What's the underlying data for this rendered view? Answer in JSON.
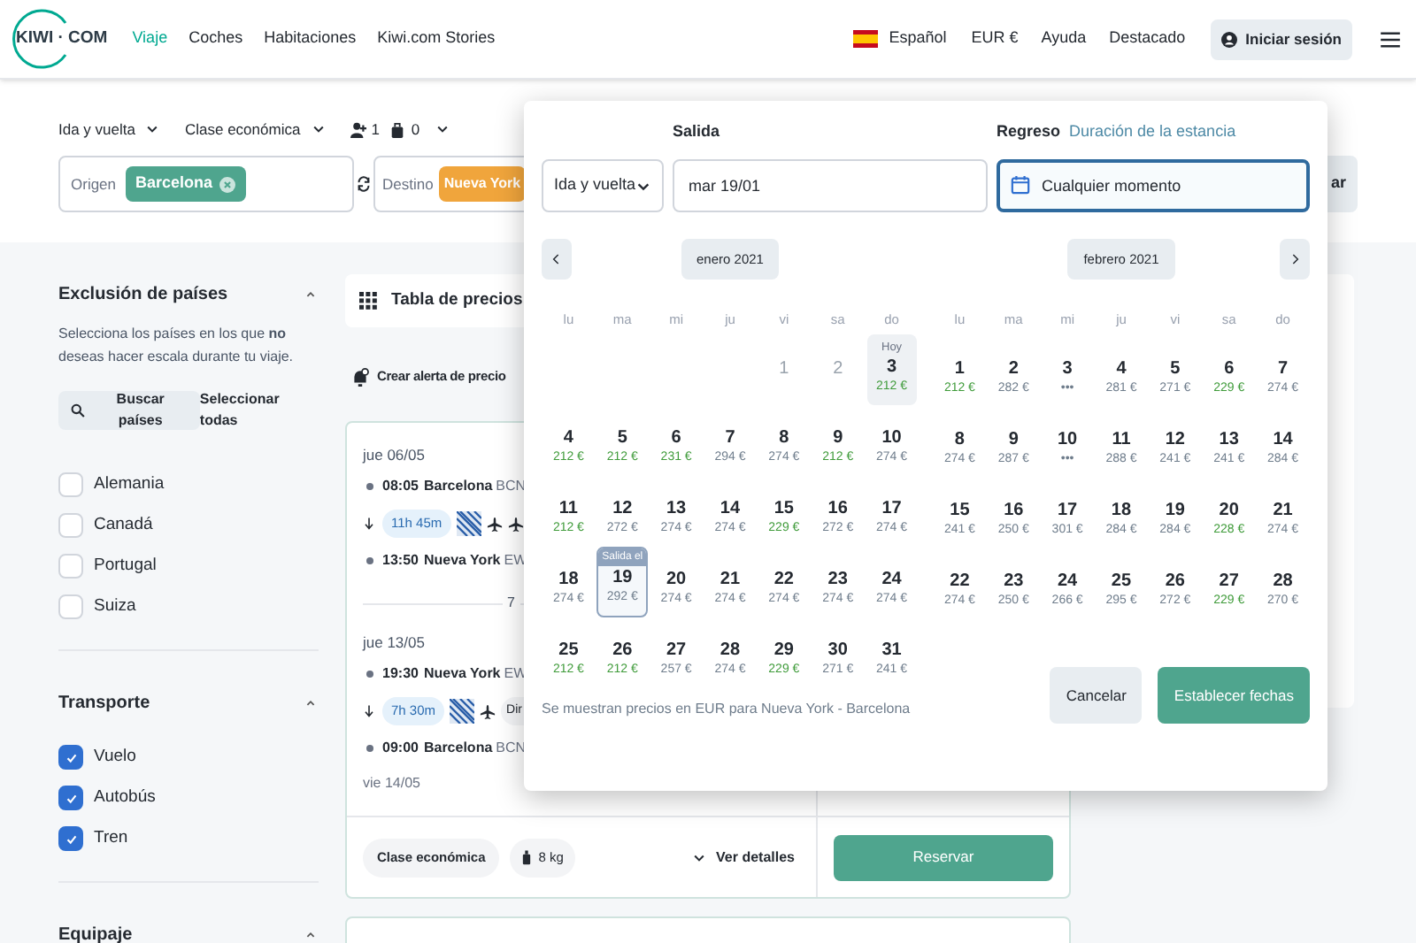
{
  "header": {
    "logo": "KIWI · COM",
    "nav": [
      {
        "label": "Viaje",
        "selected": true
      },
      {
        "label": "Coches",
        "selected": false
      },
      {
        "label": "Habitaciones",
        "selected": false
      },
      {
        "label": "Kiwi.com Stories",
        "selected": false
      }
    ],
    "language": "Español",
    "currency": "EUR €",
    "links": [
      "Ayuda",
      "Destacado"
    ],
    "login": "Iniciar sesión"
  },
  "search": {
    "trip_type": "Ida y vuelta",
    "cabin": "Clase económica",
    "adults": "1",
    "bags": "0",
    "origin": {
      "label": "Origen",
      "chip": "Barcelona"
    },
    "destination": {
      "label": "Destino",
      "chip": "Nueva York"
    },
    "search_button": "ar"
  },
  "sidebar": {
    "sections": [
      {
        "kind": "countries",
        "title": "Exclusión de países",
        "expanded": true,
        "description": "Selecciona los países en los que **no** deseas hacer escala durante tu viaje.",
        "search_button": "Buscar países",
        "select_all": "Seleccionar todas",
        "options": [
          {
            "label": "Alemania",
            "checked": false
          },
          {
            "label": "Canadá",
            "checked": false
          },
          {
            "label": "Portugal",
            "checked": false
          },
          {
            "label": "Suiza",
            "checked": false
          }
        ]
      },
      {
        "kind": "checklist",
        "title": "Transporte",
        "expanded": true,
        "options": [
          {
            "label": "Vuelo",
            "checked": true
          },
          {
            "label": "Autobús",
            "checked": true
          },
          {
            "label": "Tren",
            "checked": true
          }
        ]
      },
      {
        "kind": "checklist",
        "title": "Equipaje",
        "expanded": true
      }
    ]
  },
  "results": {
    "price_table": "Tabla de precios",
    "price_alert": "Crear alerta de precio",
    "card": {
      "legs": [
        {
          "date": "jue 06/05",
          "depart": {
            "time": "08:05",
            "city": "Barcelona",
            "code": "BCN"
          },
          "duration": "11h 45m",
          "segments": [
            {
              "kind": "flight"
            },
            {
              "kind": "flight"
            }
          ],
          "arrive": {
            "time": "13:50",
            "city": "Nueva York",
            "code": "EW"
          }
        },
        {
          "date": "jue 13/05",
          "depart": {
            "time": "19:30",
            "city": "Nueva York",
            "code": "EW"
          },
          "duration": "7h 30m",
          "segments": [
            {
              "kind": "flight"
            },
            {
              "kind": "chip",
              "label": "Dir"
            }
          ],
          "arrive": {
            "time": "09:00",
            "city": "Barcelona",
            "code": "BCN"
          },
          "arrival_date": "vie 14/05"
        }
      ],
      "nights": "7",
      "cabin": "Clase económica",
      "bag": "8 kg",
      "details": "Ver detalles",
      "book": "Reservar"
    }
  },
  "date_picker": {
    "trip_type": "Ida y vuelta",
    "departure": {
      "label": "Salida",
      "value": "mar 19/01"
    },
    "return": {
      "label": "Regreso",
      "link": "Duración de la estancia",
      "value": "Cualquier momento",
      "focused": true
    },
    "months": [
      {
        "label": "enero 2021",
        "weekdays": [
          "lu",
          "ma",
          "mi",
          "ju",
          "vi",
          "sa",
          "do"
        ],
        "weeks": [
          [
            {
              "kind": "blank"
            },
            {
              "kind": "blank"
            },
            {
              "kind": "blank"
            },
            {
              "kind": "blank"
            },
            {
              "day": "1",
              "kind": "past",
              "selected": false
            },
            {
              "day": "2",
              "kind": "past",
              "selected": false
            },
            {
              "day": "3",
              "kind": "today",
              "tag": "Hoy",
              "price": "212 €",
              "cheap": true,
              "selected": false
            }
          ],
          [
            {
              "day": "4",
              "kind": "day",
              "price": "212 €",
              "cheap": true,
              "selected": false
            },
            {
              "day": "5",
              "kind": "day",
              "price": "212 €",
              "cheap": true,
              "selected": false
            },
            {
              "day": "6",
              "kind": "day",
              "price": "231 €",
              "cheap": true,
              "selected": false
            },
            {
              "day": "7",
              "kind": "day",
              "price": "294 €",
              "cheap": false,
              "selected": false
            },
            {
              "day": "8",
              "kind": "day",
              "price": "274 €",
              "cheap": false,
              "selected": false
            },
            {
              "day": "9",
              "kind": "day",
              "price": "212 €",
              "cheap": true,
              "selected": false
            },
            {
              "day": "10",
              "kind": "day",
              "price": "274 €",
              "cheap": false,
              "selected": false
            }
          ],
          [
            {
              "day": "11",
              "kind": "day",
              "price": "212 €",
              "cheap": true,
              "selected": false
            },
            {
              "day": "12",
              "kind": "day",
              "price": "272 €",
              "cheap": false,
              "selected": false
            },
            {
              "day": "13",
              "kind": "day",
              "price": "274 €",
              "cheap": false,
              "selected": false
            },
            {
              "day": "14",
              "kind": "day",
              "price": "274 €",
              "cheap": false,
              "selected": false
            },
            {
              "day": "15",
              "kind": "day",
              "price": "229 €",
              "cheap": true,
              "selected": false
            },
            {
              "day": "16",
              "kind": "day",
              "price": "272 €",
              "cheap": false,
              "selected": false
            },
            {
              "day": "17",
              "kind": "day",
              "price": "274 €",
              "cheap": false,
              "selected": false
            }
          ],
          [
            {
              "day": "18",
              "kind": "day",
              "price": "274 €",
              "cheap": false,
              "selected": false
            },
            {
              "day": "19",
              "kind": "day",
              "tag": "Salida el",
              "price": "292 €",
              "cheap": false,
              "selected": true
            },
            {
              "day": "20",
              "kind": "day",
              "price": "274 €",
              "cheap": false,
              "selected": false
            },
            {
              "day": "21",
              "kind": "day",
              "price": "274 €",
              "cheap": false,
              "selected": false
            },
            {
              "day": "22",
              "kind": "day",
              "price": "274 €",
              "cheap": false,
              "selected": false
            },
            {
              "day": "23",
              "kind": "day",
              "price": "274 €",
              "cheap": false,
              "selected": false
            },
            {
              "day": "24",
              "kind": "day",
              "price": "274 €",
              "cheap": false,
              "selected": false
            }
          ],
          [
            {
              "day": "25",
              "kind": "day",
              "price": "212 €",
              "cheap": true,
              "selected": false
            },
            {
              "day": "26",
              "kind": "day",
              "price": "212 €",
              "cheap": true,
              "selected": false
            },
            {
              "day": "27",
              "kind": "day",
              "price": "257 €",
              "cheap": false,
              "selected": false
            },
            {
              "day": "28",
              "kind": "day",
              "price": "274 €",
              "cheap": false,
              "selected": false
            },
            {
              "day": "29",
              "kind": "day",
              "price": "229 €",
              "cheap": true,
              "selected": false
            },
            {
              "day": "30",
              "kind": "day",
              "price": "271 €",
              "cheap": false,
              "selected": false
            },
            {
              "day": "31",
              "kind": "day",
              "price": "241 €",
              "cheap": false,
              "selected": false
            }
          ]
        ]
      },
      {
        "label": "febrero 2021",
        "weekdays": [
          "lu",
          "ma",
          "mi",
          "ju",
          "vi",
          "sa",
          "do"
        ],
        "weeks": [
          [
            {
              "day": "1",
              "kind": "day",
              "price": "212 €",
              "cheap": true,
              "selected": false
            },
            {
              "day": "2",
              "kind": "day",
              "price": "282 €",
              "cheap": false,
              "selected": false
            },
            {
              "day": "3",
              "kind": "day",
              "price": "•••",
              "cheap": false,
              "selected": false
            },
            {
              "day": "4",
              "kind": "day",
              "price": "281 €",
              "cheap": false,
              "selected": false
            },
            {
              "day": "5",
              "kind": "day",
              "price": "271 €",
              "cheap": false,
              "selected": false
            },
            {
              "day": "6",
              "kind": "day",
              "price": "229 €",
              "cheap": true,
              "selected": false
            },
            {
              "day": "7",
              "kind": "day",
              "price": "274 €",
              "cheap": false,
              "selected": false
            }
          ],
          [
            {
              "day": "8",
              "kind": "day",
              "price": "274 €",
              "cheap": false,
              "selected": false
            },
            {
              "day": "9",
              "kind": "day",
              "price": "287 €",
              "cheap": false,
              "selected": false
            },
            {
              "day": "10",
              "kind": "day",
              "price": "•••",
              "cheap": false,
              "selected": false
            },
            {
              "day": "11",
              "kind": "day",
              "price": "288 €",
              "cheap": false,
              "selected": false
            },
            {
              "day": "12",
              "kind": "day",
              "price": "241 €",
              "cheap": false,
              "selected": false
            },
            {
              "day": "13",
              "kind": "day",
              "price": "241 €",
              "cheap": false,
              "selected": false
            },
            {
              "day": "14",
              "kind": "day",
              "price": "284 €",
              "cheap": false,
              "selected": false
            }
          ],
          [
            {
              "day": "15",
              "kind": "day",
              "price": "241 €",
              "cheap": false,
              "selected": false
            },
            {
              "day": "16",
              "kind": "day",
              "price": "250 €",
              "cheap": false,
              "selected": false
            },
            {
              "day": "17",
              "kind": "day",
              "price": "301 €",
              "cheap": false,
              "selected": false
            },
            {
              "day": "18",
              "kind": "day",
              "price": "284 €",
              "cheap": false,
              "selected": false
            },
            {
              "day": "19",
              "kind": "day",
              "price": "284 €",
              "cheap": false,
              "selected": false
            },
            {
              "day": "20",
              "kind": "day",
              "price": "228 €",
              "cheap": true,
              "selected": false
            },
            {
              "day": "21",
              "kind": "day",
              "price": "274 €",
              "cheap": false,
              "selected": false
            }
          ],
          [
            {
              "day": "22",
              "kind": "day",
              "price": "274 €",
              "cheap": false,
              "selected": false
            },
            {
              "day": "23",
              "kind": "day",
              "price": "250 €",
              "cheap": false,
              "selected": false
            },
            {
              "day": "24",
              "kind": "day",
              "price": "266 €",
              "cheap": false,
              "selected": false
            },
            {
              "day": "25",
              "kind": "day",
              "price": "295 €",
              "cheap": false,
              "selected": false
            },
            {
              "day": "26",
              "kind": "day",
              "price": "272 €",
              "cheap": false,
              "selected": false
            },
            {
              "day": "27",
              "kind": "day",
              "price": "229 €",
              "cheap": true,
              "selected": false
            },
            {
              "day": "28",
              "kind": "day",
              "price": "270 €",
              "cheap": false,
              "selected": false
            }
          ]
        ]
      }
    ],
    "note": "Se muestran precios en EUR para Nueva York - Barcelona",
    "buttons": [
      {
        "label": "Cancelar",
        "kind": "secondary"
      },
      {
        "label": "Establecer fechas",
        "kind": "primary"
      }
    ]
  }
}
